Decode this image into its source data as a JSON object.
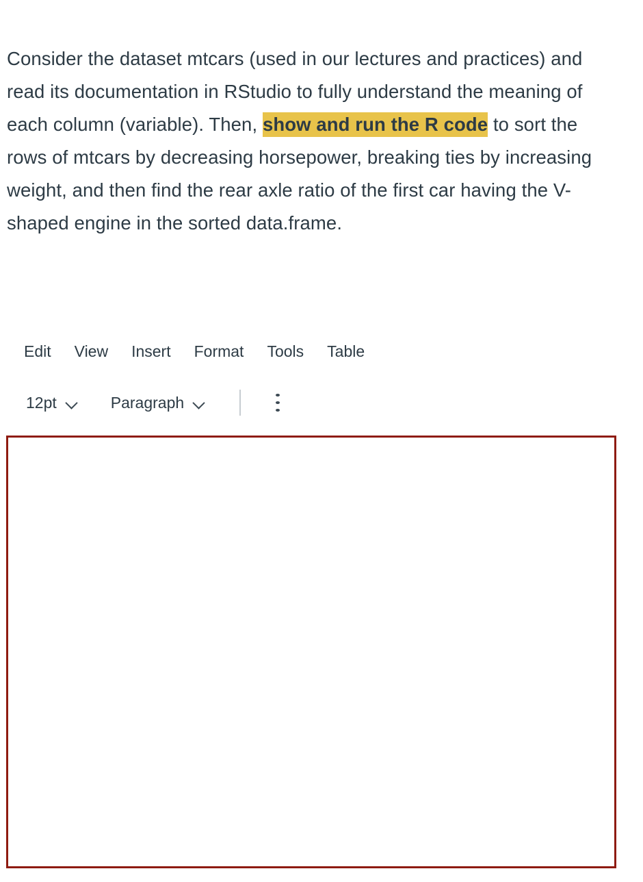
{
  "question": {
    "segments": [
      {
        "text": "Consider the dataset mtcars (used in our lectures and practices) and read its documentation in RStudio to fully understand the meaning of each column (variable). Then, ",
        "highlight": false
      },
      {
        "text": "show and run the R code",
        "highlight": true
      },
      {
        "text": " to sort the rows of mtcars by decreasing horsepower, breaking ties by increasing weight, and then find the rear axle ratio of the first car having the V-shaped engine in the sorted data.frame.",
        "highlight": false
      }
    ],
    "plain_text": "Consider the dataset mtcars (used in our lectures and practices) and read its documentation in RStudio to fully understand the meaning of each column (variable). Then, show and run the R code to sort the rows of mtcars by decreasing horsepower, breaking ties by increasing weight, and then find the rear axle ratio of the first car having the V-shaped engine in the sorted data.frame.",
    "highlight_color": "#E8C34A",
    "text_color": "#2D3B45"
  },
  "menubar": {
    "items": [
      {
        "label": "Edit"
      },
      {
        "label": "View"
      },
      {
        "label": "Insert"
      },
      {
        "label": "Format"
      },
      {
        "label": "Tools"
      },
      {
        "label": "Table"
      }
    ]
  },
  "toolbar": {
    "font_size": "12pt",
    "block_format": "Paragraph",
    "font_size_chevron": "chevron-down-icon",
    "block_format_chevron": "chevron-down-icon",
    "overflow_menu": "kebab-menu-icon"
  },
  "editor": {
    "content": "",
    "placeholder": "",
    "border_color": "#8E1B10",
    "background": "#FFFFFF"
  }
}
